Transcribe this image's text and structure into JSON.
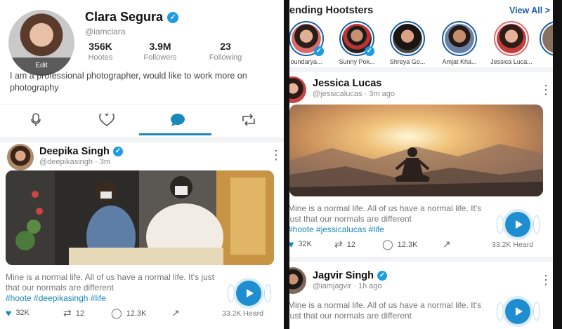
{
  "profile": {
    "name": "Clara Segura",
    "handle": "@iamclara",
    "edit_label": "Edit",
    "stats": [
      {
        "value": "356K",
        "label": "Hootes"
      },
      {
        "value": "3.9M",
        "label": "Followers"
      },
      {
        "value": "23",
        "label": "Following"
      }
    ],
    "bio": "I am a professional photographer, would like to work more on photography"
  },
  "tabs": [
    {
      "icon": "microphone-icon",
      "active": false
    },
    {
      "icon": "heart-icon",
      "active": false
    },
    {
      "icon": "chat-icon",
      "active": true
    },
    {
      "icon": "repost-icon",
      "active": false
    }
  ],
  "left_post": {
    "name": "Deepika Singh",
    "sub": "@deepikasingh · 3m",
    "text": "Mine is a normal life. All of us have a normal life. It's just that our normals are different",
    "tags": "#hoote #deepikasingh #life",
    "likes": "32K",
    "reposts": "12",
    "comments": "12.3K",
    "heard": "33.2K Heard"
  },
  "trending": {
    "title": "ending Hootsters",
    "view_all": "View All >",
    "users": [
      {
        "name": "oundarya..."
      },
      {
        "name": "Sunny Pok..."
      },
      {
        "name": "Shreya Go..."
      },
      {
        "name": "Amjat Kha..."
      },
      {
        "name": "Jessica Luca..."
      }
    ]
  },
  "right_post1": {
    "name": "Jessica Lucas",
    "sub": "@jessicalucas · 3m ago",
    "text": "Mine is a normal life. All of us have a normal life. It's just that our normals are different",
    "tags": "#hoote #jessicalucas #life",
    "likes": "32K",
    "reposts": "12",
    "comments": "12.3K",
    "heard": "33.2K Heard"
  },
  "right_post2": {
    "name": "Jagvir Singh",
    "sub": "@iamjagvir · 1h ago",
    "text": "Mine is a normal life. All of us have a normal life. It's just that our normals are different"
  },
  "colors": {
    "accent": "#1a88b8",
    "verified": "#1e9be5",
    "play": "#1f8ed0"
  }
}
